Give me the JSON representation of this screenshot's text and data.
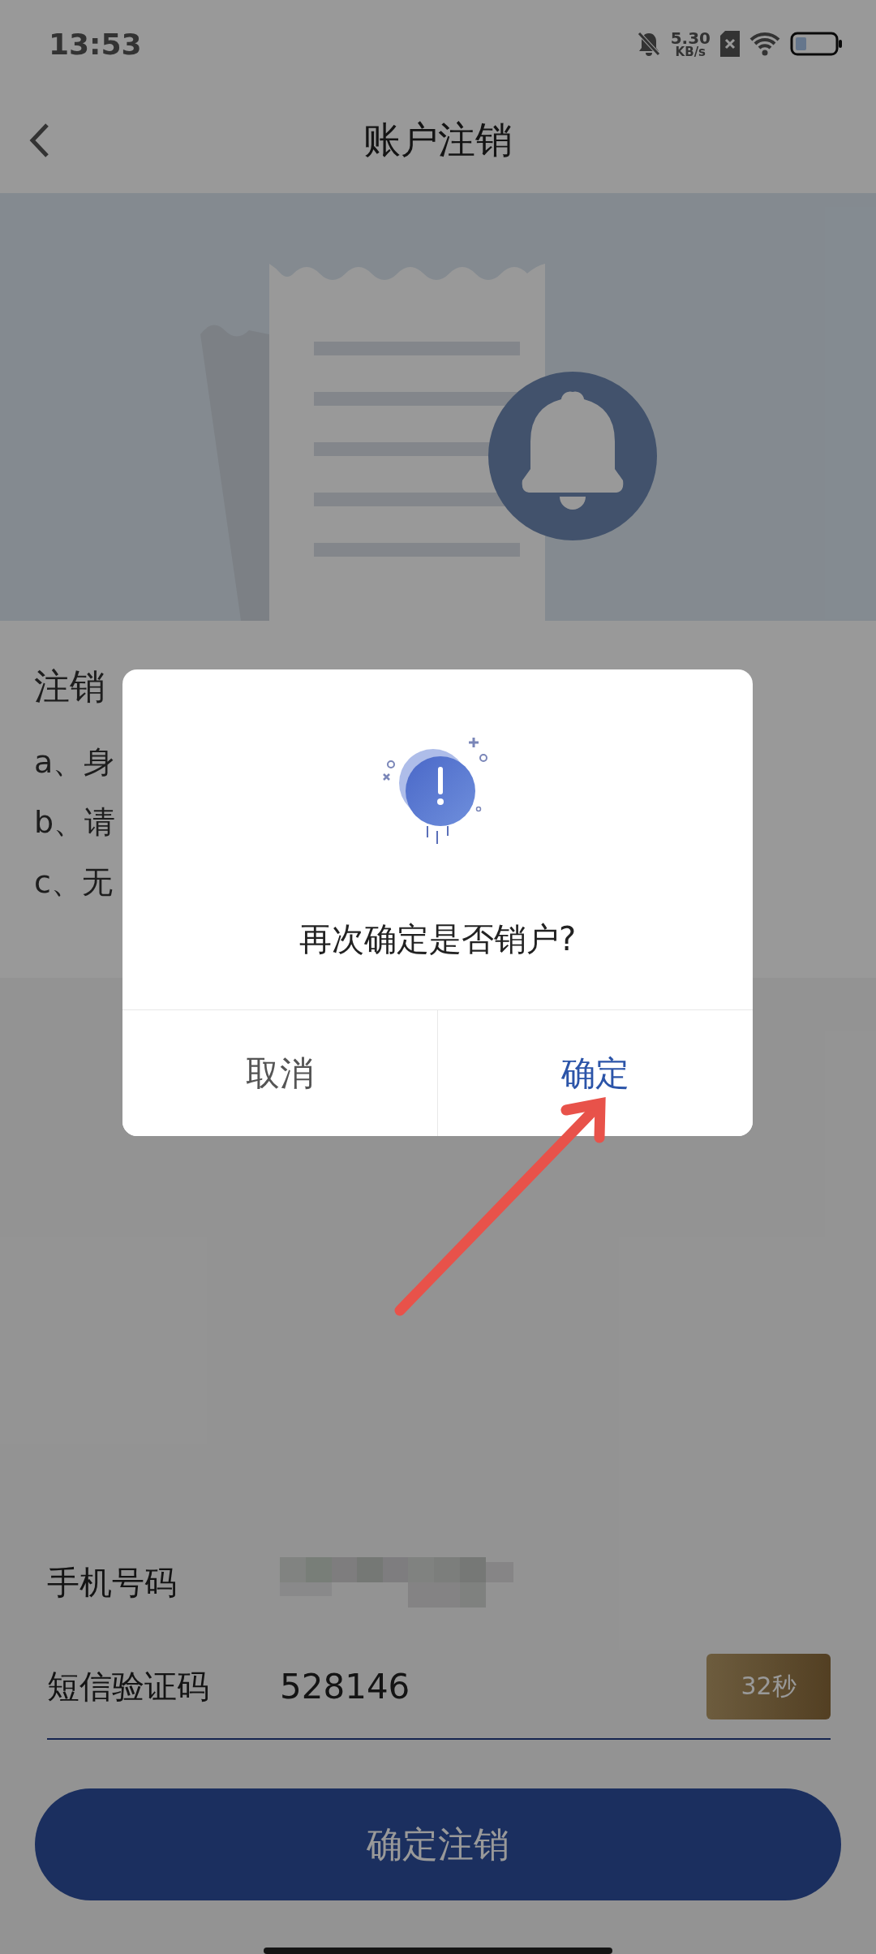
{
  "status_bar": {
    "time": "13:53",
    "net_speed": "5.30",
    "net_unit": "KB/s"
  },
  "nav": {
    "title": "账户注销"
  },
  "notice": {
    "heading": "注销",
    "items": [
      "a、身",
      "b、请",
      "c、无"
    ]
  },
  "form": {
    "fields": [
      {
        "label": "手机号码",
        "kind": "masked"
      },
      {
        "label": "短信验证码",
        "kind": "code",
        "value": "528146",
        "action": "32秒"
      }
    ]
  },
  "submit": "确定注销",
  "dialog": {
    "message": "再次确定是否销户?",
    "buttons": [
      {
        "label": "取消",
        "kind": "cancel"
      },
      {
        "label": "确定",
        "kind": "confirm"
      }
    ]
  }
}
